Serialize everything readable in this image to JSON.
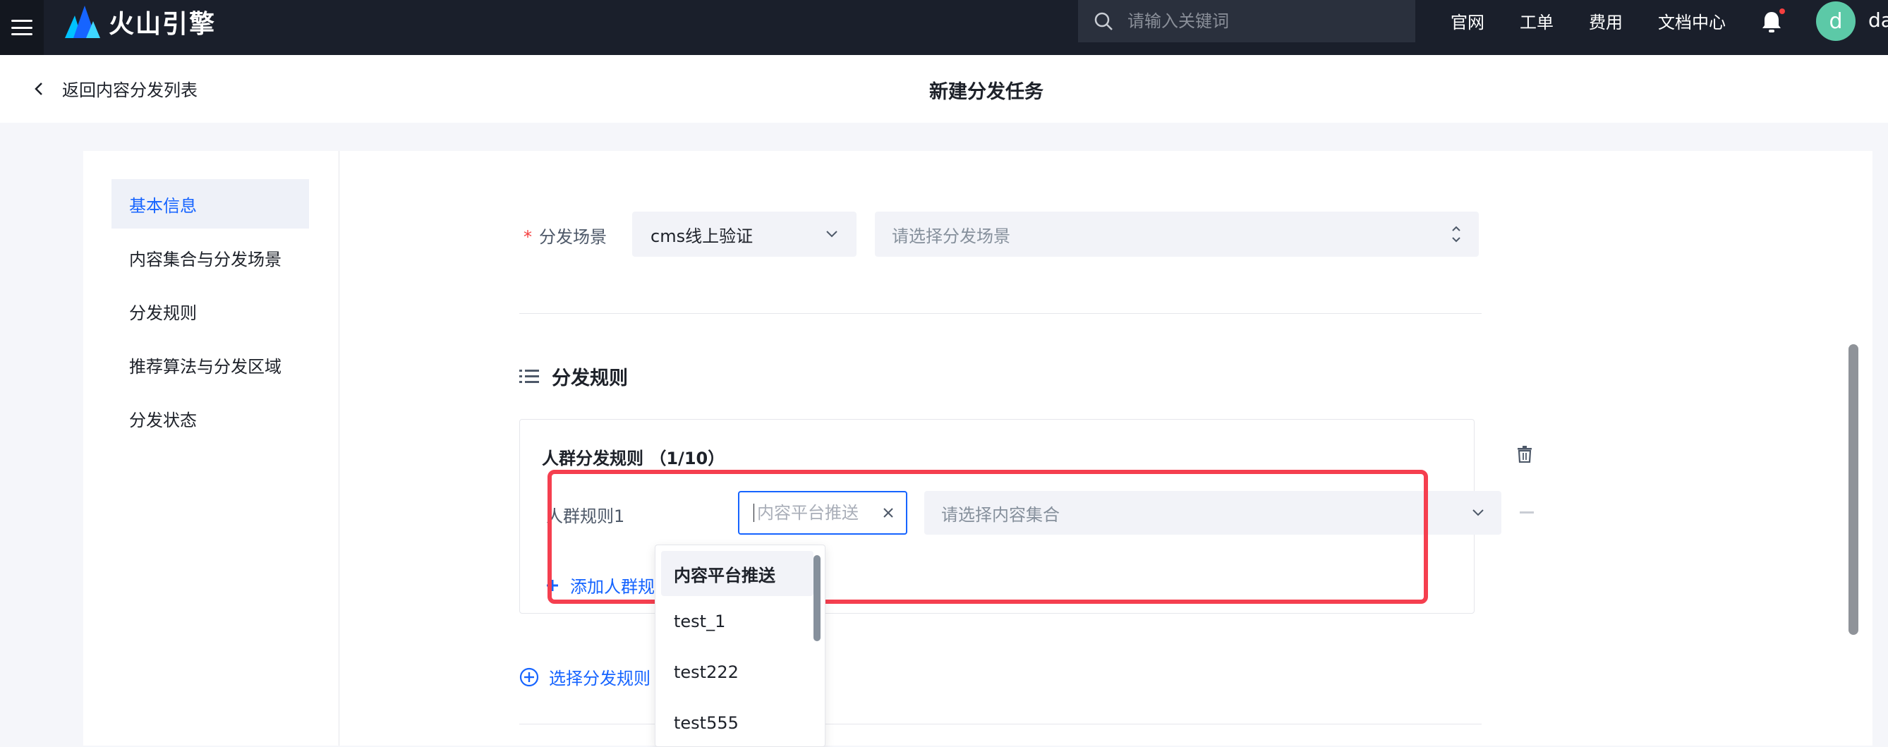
{
  "topbar": {
    "logo_text": "火山引擎",
    "search_placeholder": "请输入关键词",
    "nav_links": [
      "官网",
      "工单",
      "费用",
      "文档中心"
    ],
    "avatar_letter": "d",
    "username": "da"
  },
  "header": {
    "back_label": "返回内容分发列表",
    "title": "新建分发任务"
  },
  "sidebar": {
    "items": [
      {
        "label": "基本信息",
        "active": true
      },
      {
        "label": "内容集合与分发场景"
      },
      {
        "label": "分发规则"
      },
      {
        "label": "推荐算法与分发区域"
      },
      {
        "label": "分发状态"
      }
    ]
  },
  "form": {
    "scene_label": "分发场景",
    "scene_value": "cms线上验证",
    "scene_placeholder": "请选择分发场景",
    "rules_section_title": "分发规则",
    "crowd_rules_title": "人群分发规则 （1/10）",
    "crowd_rule_label": "人群规则1",
    "crowd_rule_input_placeholder": "内容平台推送",
    "content_set_placeholder": "请选择内容集合",
    "add_crowd_label": "添加人群规",
    "choose_rule_label": "选择分发规则"
  },
  "dropdown": {
    "options": [
      "内容平台推送",
      "test_1",
      "test222",
      "test555"
    ],
    "selected_index": 0
  },
  "colors": {
    "accent": "#1664ff",
    "topbar": "#1a1f2b",
    "highlight": "#f53f4f"
  }
}
